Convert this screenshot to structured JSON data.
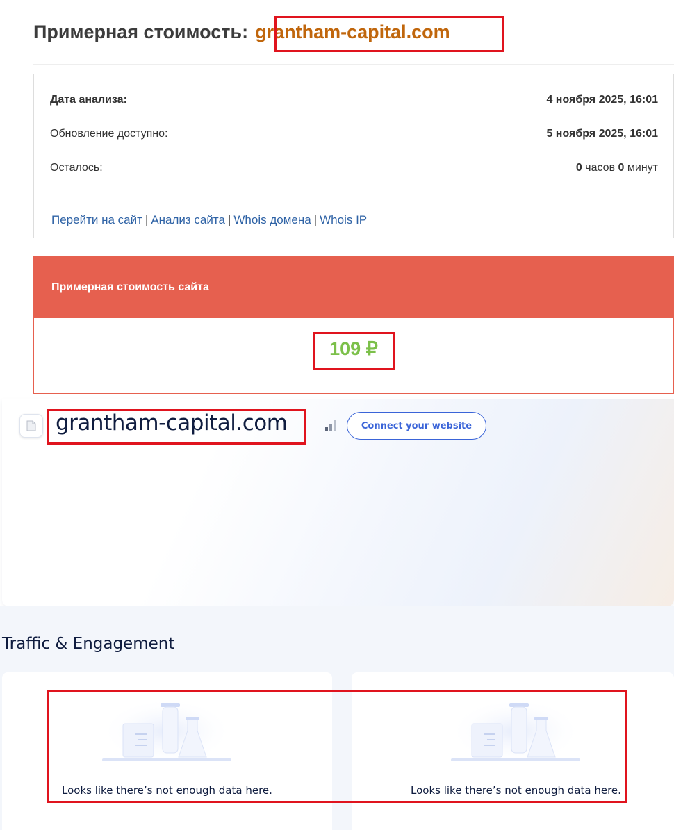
{
  "header": {
    "title": "Примерная стоимость:",
    "domain": "grantham-capital.com"
  },
  "info": {
    "rows": [
      {
        "label": "Дата анализа:",
        "value": "4 ноября 2025, 16:01"
      },
      {
        "label": "Обновление доступно:",
        "value": "5 ноября 2025, 16:01"
      }
    ],
    "remaining": {
      "label": "Осталось:",
      "hours_value": "0",
      "hours_unit": "часов",
      "minutes_value": "0",
      "minutes_unit": "минут"
    },
    "links": [
      "Перейти на сайт",
      "Анализ сайта",
      "Whois домена",
      "Whois IP"
    ],
    "separator": "|"
  },
  "cost": {
    "header": "Примерная стоимость сайта",
    "value": "109 ₽"
  },
  "site": {
    "domain": "grantham-capital.com",
    "connect_label": "Connect your website"
  },
  "traffic": {
    "title": "Traffic & Engagement",
    "empty_message": "Looks like there’s not enough data here."
  },
  "colors": {
    "highlight": "#e0141e",
    "domain": "#c0660c",
    "cost_header": "#e6604f",
    "cost_value": "#7cc04a",
    "link": "#2f63a6",
    "accent": "#3a64d8"
  },
  "icons": [
    "file-icon",
    "signal-bars-icon",
    "empty-data-illustration"
  ]
}
